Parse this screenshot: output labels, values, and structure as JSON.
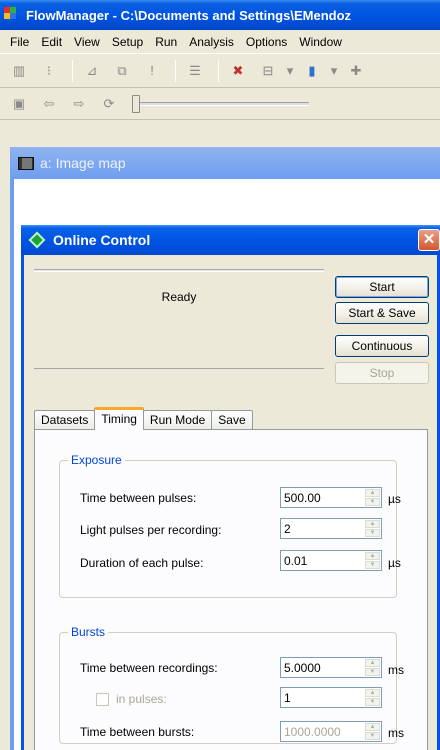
{
  "app": {
    "title": "FlowManager - C:\\Documents and Settings\\EMendoz",
    "menu": [
      "File",
      "Edit",
      "View",
      "Setup",
      "Run",
      "Analysis",
      "Options",
      "Window"
    ]
  },
  "child_window": {
    "title": "a: Image map"
  },
  "dialog": {
    "title": "Online Control",
    "status": "Ready",
    "buttons": {
      "start": "Start",
      "start_save": "Start & Save",
      "continuous": "Continuous",
      "stop": "Stop"
    },
    "tabs": [
      "Datasets",
      "Timing",
      "Run Mode",
      "Save"
    ],
    "active_tab": "Timing",
    "exposure": {
      "legend": "Exposure",
      "rows": [
        {
          "label": "Time between pulses:",
          "value": "500.00",
          "unit": "µs"
        },
        {
          "label": "Light pulses per recording:",
          "value": "2",
          "unit": ""
        },
        {
          "label": "Duration of each pulse:",
          "value": "0.01",
          "unit": "µs"
        }
      ]
    },
    "bursts": {
      "legend": "Bursts",
      "rows": [
        {
          "label": "Time between recordings:",
          "value": "5.0000",
          "unit": "ms"
        },
        {
          "label": "in pulses:",
          "value": "1",
          "unit": ""
        },
        {
          "label": "Time between bursts:",
          "value": "1000.0000",
          "unit": "ms"
        }
      ]
    }
  }
}
